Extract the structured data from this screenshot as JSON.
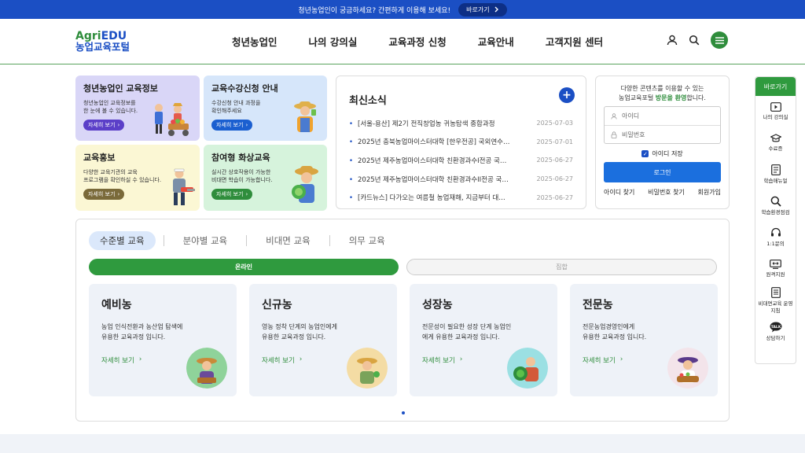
{
  "topbar": {
    "message": "청년농업인이 궁금하세요? 간편하게 이용해 보세요!",
    "button": "바로가기"
  },
  "logo": {
    "en_prefix": "Agri",
    "en_suffix": "EDU",
    "ko": "농업교육포털"
  },
  "gnb": [
    "청년농업인",
    "나의 강의실",
    "교육과정 신청",
    "교육안내",
    "고객지원 센터"
  ],
  "header_icons": [
    "user-icon",
    "search-icon",
    "menu-icon"
  ],
  "cards": [
    {
      "title": "청년농업인 교육정보",
      "desc1": "청년농업인 교육정보를",
      "desc2": "한 눈에 볼 수 있습니다.",
      "more": "자세히 보기",
      "bg": "#d9d6f7",
      "btn": "#5b3fc8"
    },
    {
      "title": "교육수강신청 안내",
      "desc1": "수강신청 안내 과정을",
      "desc2": "확인해주세요",
      "more": "자세히 보기",
      "bg": "#d6e6fa",
      "btn": "#1b5fd0"
    },
    {
      "title": "교육홍보",
      "desc1": "다양한 교육기관의 교육",
      "desc2": "프로그램을 확인하실 수 있습니다.",
      "more": "자세히 보기",
      "bg": "#fbf7d4",
      "btn": "#7a6a3a"
    },
    {
      "title": "참여형 화상교육",
      "desc1": "실시간 상호작용이 가능한",
      "desc2": "비대면 학습이 가능합니다.",
      "more": "자세히 보기",
      "bg": "#d6f3dc",
      "btn": "#2f8d3c"
    }
  ],
  "news": {
    "title": "최신소식",
    "items": [
      {
        "text": "[서울-용산] 제2기 전직창업농 귀농탐색 종합과정",
        "date": "2025-07-03"
      },
      {
        "text": "2025년 충북농업마이스터대학 [한우전공] 국외연수…",
        "date": "2025-07-01"
      },
      {
        "text": "2025년 제주농업마이스터대학 친환경과수I전공 국…",
        "date": "2025-06-27"
      },
      {
        "text": "2025년 제주농업마이스터대학 친환경과수II전공 국…",
        "date": "2025-06-27"
      },
      {
        "text": "[카드뉴스] 다가오는 여름철 농업재해, 지금부터 대…",
        "date": "2025-06-27"
      }
    ]
  },
  "login": {
    "desc_line1": "다양한 콘텐츠를 이용할 수 있는",
    "desc_prefix": "농업교육포털 ",
    "desc_highlight": "방문을 환영",
    "desc_suffix": "합니다.",
    "id_placeholder": "아이디",
    "pw_placeholder": "비밀번호",
    "save_id": "아이디 저장",
    "button": "로그인",
    "links": [
      "아이디 찾기",
      "비밀번호 찾기",
      "회원가입"
    ]
  },
  "course": {
    "tabs": [
      "수준별 교육",
      "분야별 교육",
      "비대면 교육",
      "의무 교육"
    ],
    "segments": [
      "온라인",
      "집합"
    ],
    "levels": [
      {
        "title": "예비농",
        "desc1": "농업 인식전환과 농산업 탐색에",
        "desc2": "유용한 교육과정 입니다.",
        "more": "자세히 보기",
        "avatar_bg": "#8fd39a"
      },
      {
        "title": "신규농",
        "desc1": "영농 정착 단계의 농업인에게",
        "desc2": "유용한 교육과정 입니다.",
        "more": "자세히 보기",
        "avatar_bg": "#f4dca4"
      },
      {
        "title": "성장농",
        "desc1": "전문성이 필요한 성장 단계 농업인",
        "desc2": "에게 유용한 교육과정 입니다.",
        "more": "자세히 보기",
        "avatar_bg": "#9be0e3"
      },
      {
        "title": "전문농",
        "desc1": "전문농업경영인에게",
        "desc2": "유용한 교육과정 입니다.",
        "more": "자세히 보기",
        "avatar_bg": "#f3e4ea"
      }
    ]
  },
  "quick": {
    "title": "바로가기",
    "items": [
      {
        "label": "나의 강의실",
        "icon": "play-icon"
      },
      {
        "label": "수료증",
        "icon": "graduation-cap-icon"
      },
      {
        "label": "학습매뉴얼",
        "icon": "manual-icon"
      },
      {
        "label": "학습환경점검",
        "icon": "magnifier-icon"
      },
      {
        "label": "1:1문의",
        "icon": "headset-icon"
      },
      {
        "label": "원격지원",
        "icon": "remote-icon"
      },
      {
        "label": "비대면교육 운영지침",
        "icon": "document-icon"
      },
      {
        "label": "상담하기",
        "icon": "talk-icon"
      }
    ]
  }
}
